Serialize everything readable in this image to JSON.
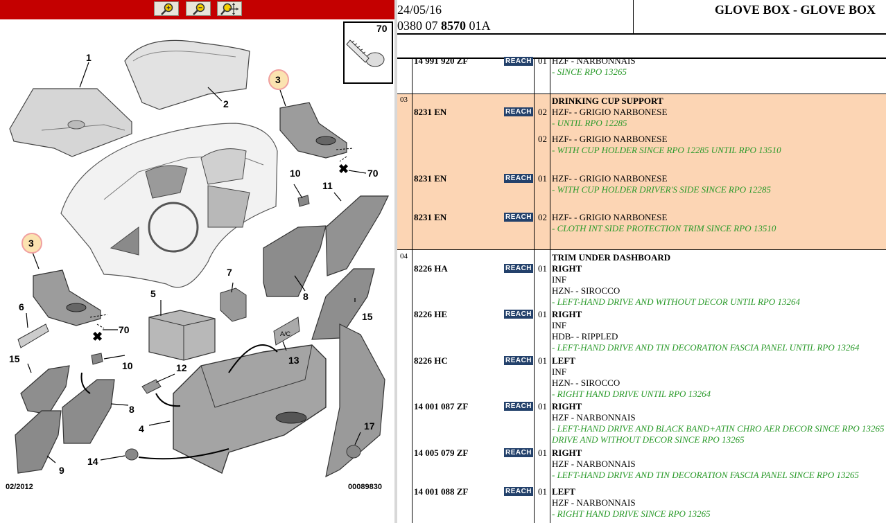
{
  "toolbar": {
    "buttons": [
      {
        "name": "zoom-in",
        "icon": "zoom-in-icon"
      },
      {
        "name": "zoom-out",
        "icon": "zoom-out-icon"
      },
      {
        "name": "zoom-pan",
        "icon": "zoom-pan-icon"
      }
    ]
  },
  "diagram": {
    "callouts": [
      "1",
      "2",
      "3",
      "3",
      "4",
      "5",
      "6",
      "7",
      "8",
      "8",
      "9",
      "10",
      "10",
      "11",
      "12",
      "13",
      "14",
      "15",
      "15",
      "17",
      "70",
      "70",
      "70"
    ],
    "screw_ref": "70",
    "ac_label": "A/C",
    "date": "02/2012",
    "ref": "00089830"
  },
  "header": {
    "date": "24/05/16",
    "ref_prefix": "0380 07 ",
    "ref_bold": "8570",
    "ref_suffix": " 01A",
    "title": "GLOVE BOX - GLOVE BOX"
  },
  "reach_label": "REACH",
  "rows": [
    {
      "part": "14 991 920 ZF",
      "qty": "01",
      "desc": "HZF - NARBONNAIS",
      "note": "- SINCE RPO 13265"
    },
    {
      "ref": "03",
      "heading": "DRINKING CUP SUPPORT"
    },
    {
      "part": "8231 EN",
      "qty": "02",
      "desc": "HZF- - GRIGIO NARBONESE",
      "note": "- UNTIL RPO 12285"
    },
    {
      "qty": "02",
      "desc": "HZF- - GRIGIO NARBONESE",
      "note": "- WITH CUP HOLDER SINCE RPO 12285 UNTIL RPO 13510"
    },
    {
      "part": "8231 EN",
      "qty": "01",
      "desc": "HZF- - GRIGIO NARBONESE",
      "note": "- WITH CUP HOLDER DRIVER'S SIDE SINCE RPO 12285"
    },
    {
      "part": "8231 EN",
      "qty": "02",
      "desc": "HZF- - GRIGIO NARBONESE",
      "note": "- CLOTH INT SIDE PROTECTION TRIM SINCE RPO 13510"
    },
    {
      "ref": "04",
      "heading": "TRIM UNDER DASHBOARD"
    },
    {
      "part": "8226 HA",
      "qty": "01",
      "side": "RIGHT",
      "inf": "INF",
      "desc": "HZN- - SIROCCO",
      "note": "- LEFT-HAND DRIVE AND WITHOUT DECOR UNTIL RPO 13264"
    },
    {
      "part": "8226 HE",
      "qty": "01",
      "side": "RIGHT",
      "inf": "INF",
      "desc": "HDB- - RIPPLED",
      "note": "- LEFT-HAND DRIVE AND TIN DECORATION FASCIA PANEL UNTIL RPO 13264"
    },
    {
      "part": "8226 HC",
      "qty": "01",
      "side": "LEFT",
      "inf": "INF",
      "desc": "HZN- - SIROCCO",
      "note": "- RIGHT HAND DRIVE UNTIL RPO 13264"
    },
    {
      "part": "14 001 087 ZF",
      "qty": "01",
      "side": "RIGHT",
      "desc": "HZF - NARBONNAIS",
      "note": "- LEFT-HAND DRIVE AND BLACK BAND+ATIN CHRO AER DECOR SINCE RPO 13265",
      "note2": "DRIVE AND WITHOUT DECOR SINCE RPO 13265"
    },
    {
      "part": "14 005 079 ZF",
      "qty": "01",
      "side": "RIGHT",
      "desc": "HZF - NARBONNAIS",
      "note": "- LEFT-HAND DRIVE AND TIN DECORATION FASCIA PANEL SINCE RPO 13265"
    },
    {
      "part": "14 001 088 ZF",
      "qty": "01",
      "side": "LEFT",
      "desc": "HZF - NARBONNAIS",
      "note": "- RIGHT HAND DRIVE SINCE RPO 13265"
    }
  ]
}
